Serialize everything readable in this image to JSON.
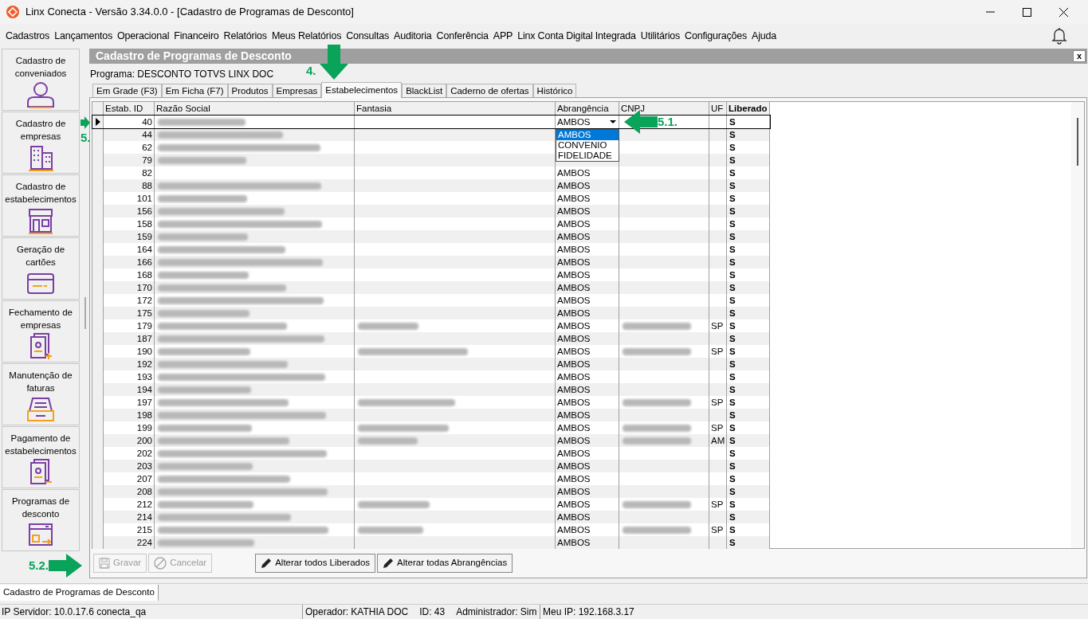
{
  "window": {
    "title": "Linx Conecta - Versão 3.34.0.0 - [Cadastro de Programas de Desconto]"
  },
  "menu": [
    "Cadastros",
    "Lançamentos",
    "Operacional",
    "Financeiro",
    "Relatórios",
    "Meus Relatórios",
    "Consultas",
    "Auditoria",
    "Conferência",
    "APP",
    "Linx Conta Digital Integrada",
    "Utilitários",
    "Configurações",
    "Ajuda"
  ],
  "sidebar": [
    {
      "label": "Cadastro de conveniados",
      "kind": "person"
    },
    {
      "label": "Cadastro de empresas",
      "kind": "buildings"
    },
    {
      "label": "Cadastro de estabelecimentos",
      "kind": "store"
    },
    {
      "label": "Geração de cartões",
      "kind": "card"
    },
    {
      "label": "Fechamento de empresas",
      "kind": "invoice-plus"
    },
    {
      "label": "Manutenção de faturas",
      "kind": "tray"
    },
    {
      "label": "Pagamento de estabelecimentos",
      "kind": "invoice-minus"
    },
    {
      "label": "Programas de desconto",
      "kind": "window-arrow"
    }
  ],
  "panel": {
    "title": "Cadastro de Programas de Desconto",
    "close": "x",
    "program": "Programa: DESCONTO TOTVS LINX DOC"
  },
  "tabs": [
    {
      "label": "Em Grade (F3)",
      "selected": false
    },
    {
      "label": "Em Ficha (F7)",
      "selected": false
    },
    {
      "label": "Produtos",
      "selected": false
    },
    {
      "label": "Empresas",
      "selected": false
    },
    {
      "label": "Estabelecimentos",
      "selected": true
    },
    {
      "label": "BlackList",
      "selected": false
    },
    {
      "label": "Caderno de ofertas",
      "selected": false
    },
    {
      "label": "Histórico",
      "selected": false
    }
  ],
  "table": {
    "columns": [
      "Estab. ID",
      "Razão Social",
      "Fantasia",
      "Abrangência",
      "CNPJ",
      "UF",
      "Liberado"
    ],
    "rows": [
      {
        "id": "40",
        "razao_redacted": true,
        "fantasia_redacted": false,
        "abrangencia": "AMBOS",
        "cnpj_redacted": false,
        "uf": "",
        "liberado": "S",
        "selected": true
      },
      {
        "id": "44",
        "razao_redacted": true,
        "fantasia_redacted": false,
        "cnpj_redacted": false,
        "uf": "",
        "liberado": "S",
        "selected": false
      },
      {
        "id": "62",
        "razao_redacted": true,
        "fantasia_redacted": false,
        "cnpj_redacted": false,
        "uf": "",
        "liberado": "S",
        "selected": false
      },
      {
        "id": "79",
        "razao_redacted": true,
        "fantasia_redacted": false,
        "cnpj_redacted": false,
        "uf": "",
        "liberado": "S",
        "selected": false
      },
      {
        "id": "82",
        "razao_redacted": false,
        "fantasia_redacted": false,
        "abrangencia": "AMBOS",
        "cnpj_redacted": false,
        "uf": "",
        "liberado": "S",
        "selected": false
      },
      {
        "id": "88",
        "razao_redacted": true,
        "fantasia_redacted": false,
        "abrangencia": "AMBOS",
        "cnpj_redacted": false,
        "uf": "",
        "liberado": "S",
        "selected": false
      },
      {
        "id": "101",
        "razao_redacted": true,
        "fantasia_redacted": false,
        "abrangencia": "AMBOS",
        "cnpj_redacted": false,
        "uf": "",
        "liberado": "S",
        "selected": false
      },
      {
        "id": "156",
        "razao_redacted": true,
        "fantasia_redacted": false,
        "abrangencia": "AMBOS",
        "cnpj_redacted": false,
        "uf": "",
        "liberado": "S",
        "selected": false
      },
      {
        "id": "158",
        "razao_redacted": true,
        "fantasia_redacted": false,
        "abrangencia": "AMBOS",
        "cnpj_redacted": false,
        "uf": "",
        "liberado": "S",
        "selected": false
      },
      {
        "id": "159",
        "razao_redacted": true,
        "fantasia_redacted": false,
        "abrangencia": "AMBOS",
        "cnpj_redacted": false,
        "uf": "",
        "liberado": "S",
        "selected": false
      },
      {
        "id": "164",
        "razao_redacted": true,
        "fantasia_redacted": false,
        "abrangencia": "AMBOS",
        "cnpj_redacted": false,
        "uf": "",
        "liberado": "S",
        "selected": false
      },
      {
        "id": "166",
        "razao_redacted": true,
        "fantasia_redacted": false,
        "abrangencia": "AMBOS",
        "cnpj_redacted": false,
        "uf": "",
        "liberado": "S",
        "selected": false
      },
      {
        "id": "168",
        "razao_redacted": true,
        "fantasia_redacted": false,
        "abrangencia": "AMBOS",
        "cnpj_redacted": false,
        "uf": "",
        "liberado": "S",
        "selected": false
      },
      {
        "id": "170",
        "razao_redacted": true,
        "fantasia_redacted": false,
        "abrangencia": "AMBOS",
        "cnpj_redacted": false,
        "uf": "",
        "liberado": "S",
        "selected": false
      },
      {
        "id": "172",
        "razao_redacted": true,
        "fantasia_redacted": false,
        "abrangencia": "AMBOS",
        "cnpj_redacted": false,
        "uf": "",
        "liberado": "S",
        "selected": false
      },
      {
        "id": "175",
        "razao_redacted": true,
        "fantasia_redacted": false,
        "abrangencia": "AMBOS",
        "cnpj_redacted": false,
        "uf": "",
        "liberado": "S",
        "selected": false
      },
      {
        "id": "179",
        "razao_redacted": true,
        "fantasia_redacted": true,
        "abrangencia": "AMBOS",
        "cnpj_redacted": true,
        "uf": "SP",
        "liberado": "S",
        "selected": false
      },
      {
        "id": "187",
        "razao_redacted": true,
        "fantasia_redacted": false,
        "abrangencia": "AMBOS",
        "cnpj_redacted": false,
        "uf": "",
        "liberado": "S",
        "selected": false
      },
      {
        "id": "190",
        "razao_redacted": true,
        "fantasia_redacted": true,
        "abrangencia": "AMBOS",
        "cnpj_redacted": true,
        "uf": "SP",
        "liberado": "S",
        "selected": false
      },
      {
        "id": "192",
        "razao_redacted": true,
        "fantasia_redacted": false,
        "abrangencia": "AMBOS",
        "cnpj_redacted": false,
        "uf": "",
        "liberado": "S",
        "selected": false
      },
      {
        "id": "193",
        "razao_redacted": true,
        "fantasia_redacted": false,
        "abrangencia": "AMBOS",
        "cnpj_redacted": false,
        "uf": "",
        "liberado": "S",
        "selected": false
      },
      {
        "id": "194",
        "razao_redacted": true,
        "fantasia_redacted": false,
        "abrangencia": "AMBOS",
        "cnpj_redacted": false,
        "uf": "",
        "liberado": "S",
        "selected": false
      },
      {
        "id": "197",
        "razao_redacted": true,
        "fantasia_redacted": true,
        "abrangencia": "AMBOS",
        "cnpj_redacted": true,
        "uf": "SP",
        "liberado": "S",
        "selected": false
      },
      {
        "id": "198",
        "razao_redacted": true,
        "fantasia_redacted": false,
        "abrangencia": "AMBOS",
        "cnpj_redacted": false,
        "uf": "",
        "liberado": "S",
        "selected": false
      },
      {
        "id": "199",
        "razao_redacted": true,
        "fantasia_redacted": true,
        "abrangencia": "AMBOS",
        "cnpj_redacted": true,
        "uf": "SP",
        "liberado": "S",
        "selected": false
      },
      {
        "id": "200",
        "razao_redacted": true,
        "fantasia_redacted": true,
        "abrangencia": "AMBOS",
        "cnpj_redacted": true,
        "uf": "AM",
        "liberado": "S",
        "selected": false
      },
      {
        "id": "202",
        "razao_redacted": true,
        "fantasia_redacted": false,
        "abrangencia": "AMBOS",
        "cnpj_redacted": false,
        "uf": "",
        "liberado": "S",
        "selected": false
      },
      {
        "id": "203",
        "razao_redacted": true,
        "fantasia_redacted": false,
        "abrangencia": "AMBOS",
        "cnpj_redacted": false,
        "uf": "",
        "liberado": "S",
        "selected": false
      },
      {
        "id": "207",
        "razao_redacted": true,
        "fantasia_redacted": false,
        "abrangencia": "AMBOS",
        "cnpj_redacted": false,
        "uf": "",
        "liberado": "S",
        "selected": false
      },
      {
        "id": "208",
        "razao_redacted": true,
        "fantasia_redacted": false,
        "abrangencia": "AMBOS",
        "cnpj_redacted": false,
        "uf": "",
        "liberado": "S",
        "selected": false
      },
      {
        "id": "212",
        "razao_redacted": true,
        "fantasia_redacted": true,
        "abrangencia": "AMBOS",
        "cnpj_redacted": true,
        "uf": "SP",
        "liberado": "S",
        "selected": false
      },
      {
        "id": "214",
        "razao_redacted": true,
        "fantasia_redacted": false,
        "abrangencia": "AMBOS",
        "cnpj_redacted": false,
        "uf": "",
        "liberado": "S",
        "selected": false
      },
      {
        "id": "215",
        "razao_redacted": true,
        "fantasia_redacted": true,
        "abrangencia": "AMBOS",
        "cnpj_redacted": true,
        "uf": "SP",
        "liberado": "S",
        "selected": false
      },
      {
        "id": "224",
        "razao_redacted": true,
        "fantasia_redacted": false,
        "abrangencia": "AMBOS",
        "cnpj_redacted": false,
        "uf": "",
        "liberado": "S",
        "selected": false
      }
    ],
    "dropdown": [
      {
        "label": "AMBOS",
        "selected": true
      },
      {
        "label": "CONVENIO",
        "selected": false
      },
      {
        "label": "FIDELIDADE",
        "selected": false
      }
    ]
  },
  "buttons": [
    {
      "label": "Gravar",
      "disabled": true,
      "kind": "save"
    },
    {
      "label": "Cancelar",
      "disabled": true,
      "kind": "cancel"
    },
    {
      "label": "Alterar todos Liberados",
      "disabled": false,
      "kind": "edit"
    },
    {
      "label": "Alterar todas Abrangências",
      "disabled": false,
      "kind": "edit"
    }
  ],
  "annotations": [
    "4.",
    "5.",
    "5.1.",
    "5.2."
  ],
  "open_windows": [
    {
      "label": "Cadastro de Programas de Desconto",
      "selected": true
    }
  ],
  "status_bar": [
    "IP Servidor: 10.0.17.6 conecta_qa",
    "Operador: KATHIA DOC",
    "ID: 43",
    "Administrador: Sim",
    "Meu IP: 192.168.3.17"
  ]
}
